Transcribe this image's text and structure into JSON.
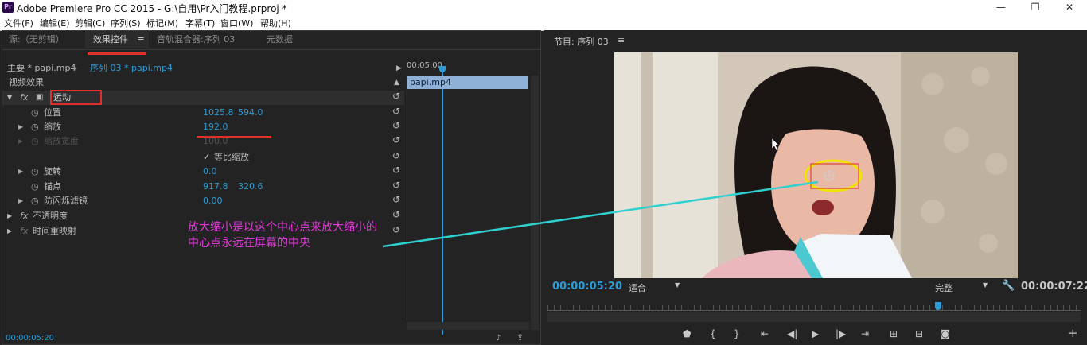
{
  "window": {
    "title": "Adobe Premiere Pro CC 2015 - G:\\自用\\Pr入门教程.prproj *",
    "app_icon": "Pr",
    "controls": {
      "minimize": "—",
      "maximize": "❐",
      "close": "✕"
    }
  },
  "menu": [
    "文件(F)",
    "编辑(E)",
    "剪辑(C)",
    "序列(S)",
    "标记(M)",
    "字幕(T)",
    "窗口(W)",
    "帮助(H)"
  ],
  "left_tabs": [
    {
      "label": "源:（无剪辑）"
    },
    {
      "label": "效果控件"
    },
    {
      "label": "音轨混合器:序列 03"
    },
    {
      "label": "元数据"
    }
  ],
  "tab_menu_glyph": "≡",
  "clip_bar": {
    "master": "主要 * papi.mp4",
    "sequence": "序列 03 * papi.mp4",
    "timeline_start": "00:05:00",
    "clip_name": "papi.mp4"
  },
  "effects": {
    "header": "视频效果",
    "motion": "运动",
    "fx_symbol": "fx",
    "rows": [
      {
        "label": "位置",
        "v1": "1025.8",
        "v2": "594.0"
      },
      {
        "label": "缩放",
        "v1": "192.0"
      },
      {
        "label": "缩放宽度",
        "v1": "100.0"
      },
      {
        "label": "等比缩放",
        "checked": true
      },
      {
        "label": "旋转",
        "v1": "0.0"
      },
      {
        "label": "锚点",
        "v1": "917.8",
        "v2": "320.6"
      },
      {
        "label": "防闪烁滤镜",
        "v1": "0.00"
      }
    ],
    "opacity": "不透明度",
    "time_remap": "时间重映射"
  },
  "left_timecode": "00:00:05:20",
  "annotation": {
    "line1": "放大缩小是以这个中心点来放大缩小的",
    "line2": "中心点永远在屏幕的中央",
    "color": "#e23bdc"
  },
  "program": {
    "title": "节目: 序列 03",
    "timecode": "00:00:05:20",
    "fit": "适合",
    "quality": "完整",
    "duration": "00:00:07:22"
  },
  "transport": {
    "marker": "marker-icon",
    "in": "{",
    "out": "}",
    "goto_in": "go-to-in-icon",
    "step_back": "step-back-icon",
    "play": "▶",
    "step_fwd": "step-forward-icon",
    "goto_out": "go-to-out-icon",
    "lift": "lift-icon",
    "extract": "extract-icon",
    "export_frame": "camera-icon",
    "add": "+"
  },
  "colors": {
    "accent_blue": "#2c9bd6",
    "highlight_red": "#e0302b",
    "ellipse_yellow": "#f2e400",
    "arrow_cyan": "#2fd0d0"
  }
}
